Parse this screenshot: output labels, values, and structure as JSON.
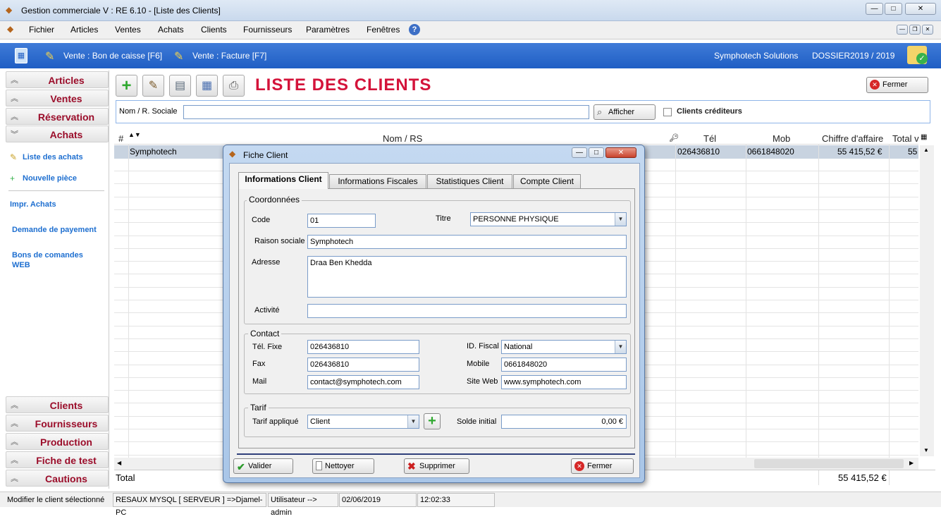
{
  "window": {
    "title": "Gestion commerciale  V : RE 6.10 - [Liste des Clients]"
  },
  "menu": [
    "Fichier",
    "Articles",
    "Ventes",
    "Achats",
    "Clients",
    "Fournisseurs",
    "Paramètres",
    "Fenêtres"
  ],
  "toolbar": {
    "vente_caisse": "Vente : Bon de caisse [F6]",
    "vente_facture": "Vente : Facture [F7]",
    "company": "Symphotech Solutions",
    "dossier": "DOSSIER2019  /  2019"
  },
  "nav": {
    "top": [
      "Articles",
      "Ventes",
      "Réservation",
      "Achats"
    ],
    "links": {
      "liste_achats": "Liste des achats",
      "nouvelle_piece": "Nouvelle pièce",
      "impr_achats": "Impr. Achats",
      "demande_payement": "Demande de payement",
      "bons_commandes_1": "Bons de comandes",
      "bons_commandes_2": "WEB"
    },
    "bottom": [
      "Clients",
      "Fournisseurs",
      "Production",
      "Fiche de test",
      "Cautions"
    ]
  },
  "main": {
    "title": "LISTE DES CLIENTS",
    "fermer": "Fermer",
    "search_label": "Nom / R. Sociale",
    "afficher": "Afficher",
    "clients_crediteurs": "Clients créditeurs"
  },
  "grid": {
    "headers": {
      "num": "#",
      "nom": "Nom / RS",
      "tel": "Tél",
      "mob": "Mob",
      "ca": "Chiffre d'affaire",
      "total": "Total v"
    },
    "row": {
      "nom": "Symphotech",
      "tel": "026436810",
      "mob": "0661848020",
      "ca": "55 415,52 €",
      "total": "55"
    },
    "footer": {
      "label": "Total",
      "ca": "55 415,52 €"
    }
  },
  "status": {
    "hint": "Modifier le client sélectionné",
    "server": "RESAUX MYSQL [ SERVEUR ] =>Djamel-PC",
    "user": "Utilisateur -->  admin",
    "date": "02/06/2019",
    "time": "12:02:33"
  },
  "dialog": {
    "title": "Fiche Client",
    "tabs": [
      "Informations Client",
      "Informations Fiscales",
      "Statistiques Client",
      "Compte Client"
    ],
    "coord": {
      "legend": "Coordonnées",
      "code_l": "Code",
      "code_v": "01",
      "titre_l": "Titre",
      "titre_v": "PERSONNE PHYSIQUE",
      "raison_l": "Raison sociale",
      "raison_v": "Symphotech",
      "adresse_l": "Adresse",
      "adresse_v": "Draa Ben Khedda",
      "activite_l": "Activité",
      "activite_v": ""
    },
    "contact": {
      "legend": "Contact",
      "telfixe_l": "Tél. Fixe",
      "telfixe_v": "026436810",
      "fax_l": "Fax",
      "fax_v": "026436810",
      "mail_l": "Mail",
      "mail_v": "contact@symphotech.com",
      "idfiscal_l": "ID. Fiscal",
      "idfiscal_v": "National",
      "mobile_l": "Mobile",
      "mobile_v": "0661848020",
      "site_l": "Site Web",
      "site_v": "www.symphotech.com"
    },
    "tarif": {
      "legend": "Tarif",
      "applique_l": "Tarif appliqué",
      "applique_v": "Client",
      "solde_l": "Solde initial",
      "solde_v": "0,00 €"
    },
    "buttons": {
      "valider": "Valider",
      "nettoyer": "Nettoyer",
      "supprimer": "Supprimer",
      "fermer": "Fermer"
    }
  }
}
